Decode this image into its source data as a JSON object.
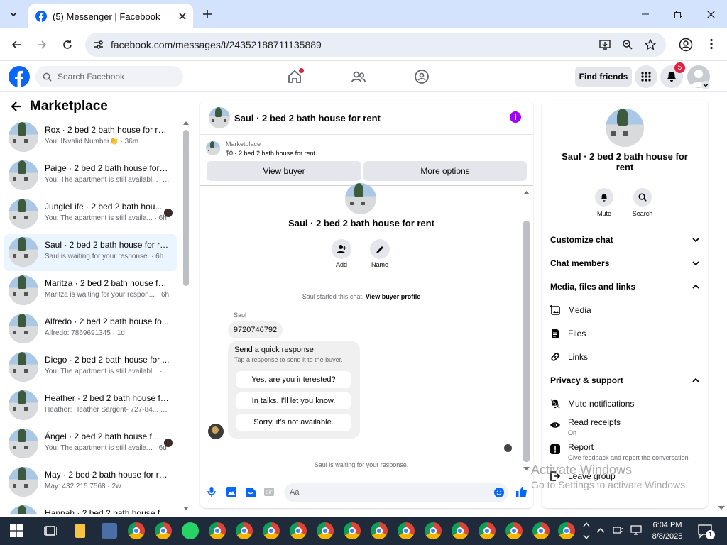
{
  "browser": {
    "tab_title": "(5) Messenger | Facebook",
    "url": "facebook.com/messages/t/24352188711135889"
  },
  "fb": {
    "search_placeholder": "Search Facebook",
    "find_friends": "Find friends",
    "notif_count": "5"
  },
  "left": {
    "title": "Marketplace",
    "conversations": [
      {
        "name": "Rox · 2 bed 2 bath house for rent",
        "preview": "You: INvalid Number👏 · 36m"
      },
      {
        "name": "Paige · 2 bed 2 bath house for r...",
        "preview": "You: The apartment is still availabl... · 6h"
      },
      {
        "name": "JungleLife · 2 bed 2 bath hou...",
        "preview": "You: The apartment is still availa... · 6h"
      },
      {
        "name": "Saul · 2 bed 2 bath house for rent",
        "preview": "Saul is waiting for your response. · 6h"
      },
      {
        "name": "Maritza · 2 bed 2 bath house fo...",
        "preview": "Maritza is waiting for your respon... · 6h"
      },
      {
        "name": "Alfredo · 2 bed 2 bath house fo...",
        "preview": "Alfredo: 7869691345 · 1d"
      },
      {
        "name": "Diego · 2 bed 2 bath house for ...",
        "preview": "You: The apartment is still availabl... · 1d"
      },
      {
        "name": "Heather · 2 bed 2 bath house fo...",
        "preview": "Heather: Heather Sargent- 727-84... · 2d"
      },
      {
        "name": "Ángel · 2 bed 2 bath house f...",
        "preview": "You: The apartment is still availa... · 6d"
      },
      {
        "name": "May · 2 bed 2 bath house for rent",
        "preview": "May: 432 215 7568 · 2w"
      },
      {
        "name": "Hannah · 2 bed 2 bath house fo...",
        "preview": ""
      }
    ]
  },
  "chat": {
    "header_title": "Saul · 2 bed 2 bath house for rent",
    "listing_source": "Marketplace",
    "listing_line": "$0 - 2 bed 2 bath house for rent",
    "view_buyer": "View buyer",
    "more_options": "More options",
    "profile_title": "Saul · 2 bed 2 bath house for rent",
    "add_label": "Add",
    "name_label": "Name",
    "started_text": "Saul started this chat.",
    "view_profile_link": "View buyer profile",
    "sender": "Saul",
    "message": "9720746792",
    "quick_title": "Send a quick response",
    "quick_subtitle": "Tap a response to send it to the buyer.",
    "quick_1": "Yes, are you interested?",
    "quick_2": "In talks. I'll let you know.",
    "quick_3": "Sorry, it's not available.",
    "waiting": "Saul is waiting for your response.",
    "input_placeholder": "Aa"
  },
  "right": {
    "title_line1": "Saul · 2 bed 2 bath house for",
    "title_line2": "rent",
    "mute": "Mute",
    "search": "Search",
    "customize": "Customize chat",
    "members": "Chat members",
    "media_section": "Media, files and links",
    "media": "Media",
    "files": "Files",
    "links": "Links",
    "privacy": "Privacy & support",
    "mute_notifications": "Mute notifications",
    "read_receipts": "Read receipts",
    "read_receipts_state": "On",
    "report": "Report",
    "report_desc": "Give feedback and report the conversation",
    "leave_group": "Leave group"
  },
  "watermark": {
    "line1": "Activate Windows",
    "line2": "Go to Settings to activate Windows."
  },
  "taskbar": {
    "time": "6:04 PM",
    "date": "8/8/2025",
    "notif": "1"
  },
  "colors": {
    "fb_blue": "#0866ff",
    "purple_info": "#a100f2",
    "badge_red": "#e41e3f"
  }
}
